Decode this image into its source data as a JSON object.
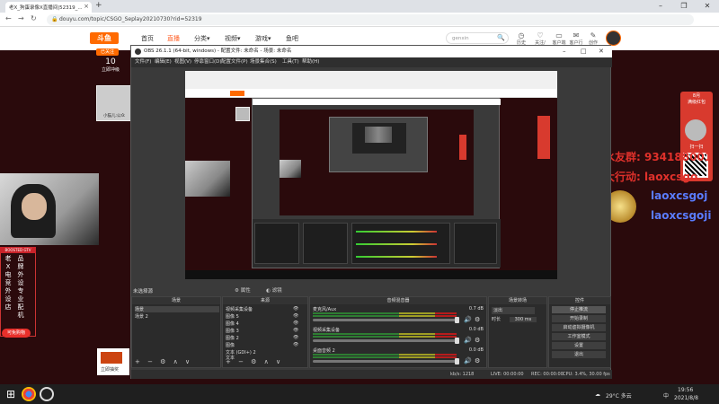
{
  "browser": {
    "tab_title": "老X_狗蛋录像X直播间|52319_...",
    "address": "douyu.com/topic/CSGO_Seplay20210730?rid=52319",
    "new_tab": "+",
    "nav_back": "←",
    "nav_forward": "→",
    "nav_reload": "↻",
    "win_min": "–",
    "win_max": "❐",
    "win_close": "✕"
  },
  "douyu": {
    "logo": "斗鱼",
    "nav": [
      "首页",
      "直播",
      "分类▾",
      "视频▾",
      "游戏▾",
      "鱼吧"
    ],
    "search_placeholder": "genxin",
    "header_icons": [
      "历史",
      "关注/赞",
      "客户端",
      "客户行为",
      "创作"
    ],
    "room_badge": "已关注",
    "room_level": "10",
    "room_level_label": "立即冲级"
  },
  "left": {
    "cat_caption": "小猫儿:公众",
    "banner_title": "BOOSTED GTV",
    "vertical_text_1": [
      "老",
      "X",
      "电",
      "竞",
      "外",
      "设",
      "店"
    ],
    "vertical_text_2": [
      "品",
      "牌",
      "外",
      "设",
      "专",
      "业",
      "配",
      "机"
    ],
    "game_button": "可免购物",
    "bottom_card_text": "立即抽奖"
  },
  "promo": {
    "qq_group": "水友群: 934188001",
    "activity": "大行动: laoxcsgo",
    "handle_1": "laoxcsgoj",
    "handle_2": "laoxcsgoji",
    "red_title": "8月\n满级红包",
    "red_sub": "扫一扫"
  },
  "obs": {
    "title": "OBS 26.1.1 (64-bit, windows) - 配置文件: 未命名 - 场景: 未命名",
    "win_min": "–",
    "win_max": "□",
    "win_close": "✕",
    "menu": [
      "文件(F)",
      "编辑(E)",
      "视图(V)",
      "停靠窗口(D)",
      "配置文件(P)",
      "场景集合(S)",
      "工具(T)",
      "帮助(H)"
    ],
    "no_source": "未选择源",
    "props_btn": "属性",
    "filters_btn": "滤镜",
    "docks": {
      "scenes": {
        "title": "场景",
        "items": [
          "场景",
          "场景 2"
        ]
      },
      "sources": {
        "title": "来源",
        "items": [
          "视频采集设备",
          "图像 5",
          "图像 4",
          "图像 3",
          "图像 2",
          "图像",
          "文本 (GDI+) 2",
          "文本"
        ]
      },
      "mixer": {
        "title": "音频混音器",
        "rows": [
          {
            "name": "麦克风/Aux",
            "db": "0.7 dB"
          },
          {
            "name": "视频采集设备",
            "db": "0.0 dB"
          },
          {
            "name": "桌面音频 2",
            "db": "0.0 dB"
          }
        ]
      },
      "transitions": {
        "title": "场景转场",
        "selected": "淡出",
        "duration_label": "时长",
        "duration_value": "300 ms"
      },
      "controls": {
        "title": "控件",
        "buttons": [
          "停止推流",
          "开始录制",
          "启动虚拟摄像机",
          "工作室模式",
          "设置",
          "退出"
        ]
      }
    },
    "footer_tools": "+ − ⚙ ∧ ∨",
    "status": {
      "live": "LIVE: 00:00:00",
      "rec": "REC: 00:00:00",
      "cpu": "CPU: 3.4%, 30.00 fps",
      "kb": "kb/s: 1218"
    }
  },
  "taskbar": {
    "weather": "29°C 多云",
    "time": "19:56",
    "date": "2021/8/8",
    "ime": "中"
  },
  "colors": {
    "brand": "#ff6a00",
    "bg_dark_red": "#2a0a0c",
    "promo_red": "#e0312b",
    "promo_blue": "#5a7cff"
  }
}
